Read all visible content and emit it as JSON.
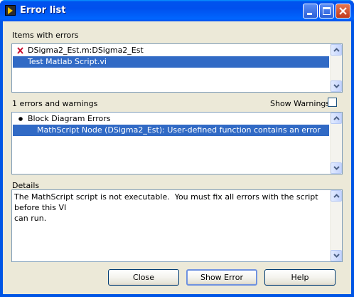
{
  "window": {
    "title": "Error list"
  },
  "items_section": {
    "label": "Items with errors",
    "items": [
      {
        "text": "DSigma2_Est.m:DSigma2_Est",
        "icon": "error-x-icon",
        "selected": false
      },
      {
        "text": "Test Matlab Script.vi",
        "selected": true
      }
    ]
  },
  "errors_section": {
    "count_label": "1 errors and warnings",
    "show_warnings_label": "Show Warnings",
    "show_warnings_checked": false,
    "items": [
      {
        "text": "Block Diagram Errors",
        "icon": "bullet-icon",
        "selected": false
      },
      {
        "text": "MathScript Node (DSigma2_Est): User-defined function contains an error",
        "selected": true
      }
    ]
  },
  "details_section": {
    "label": "Details",
    "text": "The MathScript script is not executable.  You must fix all errors with the script before this VI\ncan run."
  },
  "buttons": {
    "close": "Close",
    "show_error": "Show Error",
    "help": "Help"
  },
  "colors": {
    "selection": "#316AC5",
    "title_bar": "#0053EE",
    "dialog_bg": "#ECE9D8"
  }
}
